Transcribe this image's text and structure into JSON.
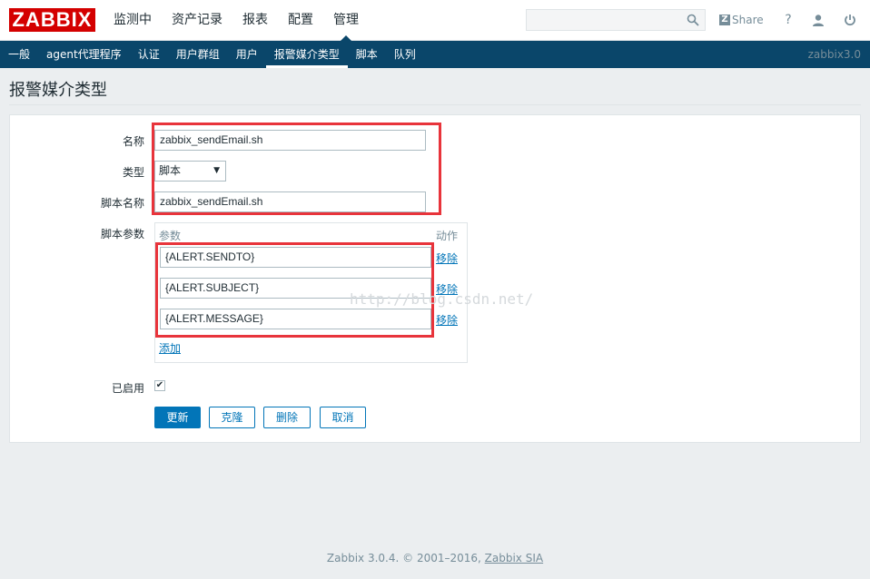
{
  "header": {
    "logo": "ZABBIX",
    "menu": [
      "监测中",
      "资产记录",
      "报表",
      "配置",
      "管理"
    ],
    "active_menu": "管理",
    "search": {
      "placeholder": "",
      "icon": "search-icon"
    },
    "share_label": "Share",
    "help_icon": "?",
    "icons": [
      "search-icon",
      "share-icon",
      "help-icon",
      "user-icon",
      "power-icon"
    ]
  },
  "subnav": {
    "items": [
      "一般",
      "agent代理程序",
      "认证",
      "用户群组",
      "用户",
      "报警媒介类型",
      "脚本",
      "队列"
    ],
    "active": "报警媒介类型",
    "version": "zabbix3.0"
  },
  "page": {
    "title": "报警媒介类型"
  },
  "form": {
    "name_label": "名称",
    "name_value": "zabbix_sendEmail.sh",
    "type_label": "类型",
    "type_value": "脚本",
    "script_name_label": "脚本名称",
    "script_name_value": "zabbix_sendEmail.sh",
    "params_label": "脚本参数",
    "params_header_param": "参数",
    "params_header_action": "动作",
    "params": [
      {
        "value": "{ALERT.SENDTO}",
        "remove": "移除"
      },
      {
        "value": "{ALERT.SUBJECT}",
        "remove": "移除"
      },
      {
        "value": "{ALERT.MESSAGE}",
        "remove": "移除"
      }
    ],
    "add_label": "添加",
    "enabled_label": "已启用",
    "enabled": true,
    "buttons": {
      "update": "更新",
      "clone": "克隆",
      "delete": "删除",
      "cancel": "取消"
    }
  },
  "watermark": "http://blog.csdn.net/",
  "footer": {
    "text": "Zabbix 3.0.4. © 2001–2016, ",
    "link": "Zabbix SIA"
  },
  "colors": {
    "brand_red": "#d40000",
    "nav_blue": "#0a466a",
    "accent": "#0275b8",
    "highlight_red": "#e8343b"
  }
}
